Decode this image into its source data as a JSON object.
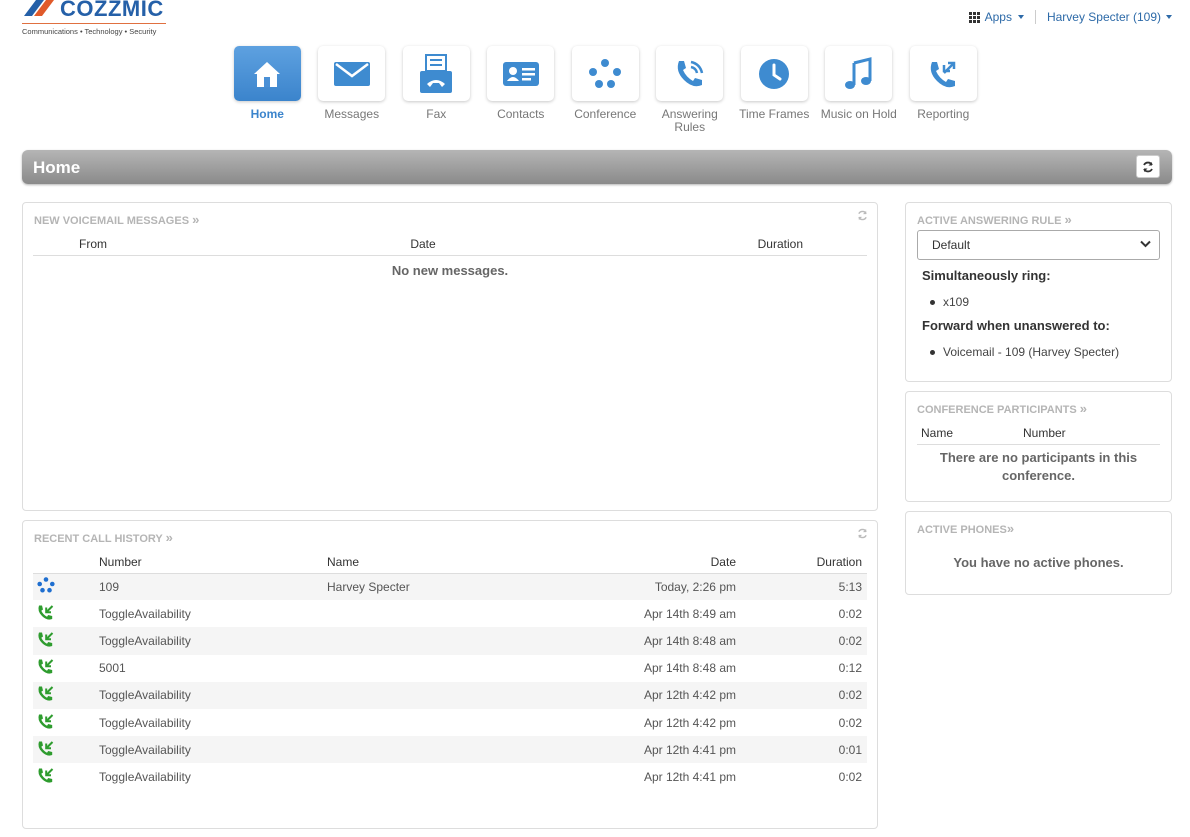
{
  "logo": {
    "brand": "COZZMIC",
    "tagline": "Communications • Technology • Security"
  },
  "topbar": {
    "apps_label": "Apps",
    "user_label": "Harvey Specter (109)"
  },
  "nav": {
    "items": [
      {
        "label": "Home",
        "icon": "home-icon",
        "active": true
      },
      {
        "label": "Messages",
        "icon": "envelope-icon",
        "active": false
      },
      {
        "label": "Fax",
        "icon": "fax-icon",
        "active": false
      },
      {
        "label": "Contacts",
        "icon": "contact-card-icon",
        "active": false
      },
      {
        "label": "Conference",
        "icon": "conference-dots-icon",
        "active": false
      },
      {
        "label": "Answering Rules",
        "icon": "phone-ringing-icon",
        "active": false
      },
      {
        "label": "Time Frames",
        "icon": "clock-icon",
        "active": false
      },
      {
        "label": "Music on Hold",
        "icon": "music-note-icon",
        "active": false
      },
      {
        "label": "Reporting",
        "icon": "phone-arrows-icon",
        "active": false
      }
    ]
  },
  "page": {
    "title": "Home"
  },
  "voicemail": {
    "title": "NEW VOICEMAIL MESSAGES",
    "columns": {
      "from": "From",
      "date": "Date",
      "duration": "Duration"
    },
    "empty": "No new messages."
  },
  "call_history": {
    "title": "RECENT CALL HISTORY",
    "columns": {
      "number": "Number",
      "name": "Name",
      "date": "Date",
      "duration": "Duration"
    },
    "rows": [
      {
        "icon": "conference-dots-icon",
        "number": "109",
        "number_is_link": true,
        "name": "Harvey Specter",
        "date": "Today, 2:26 pm",
        "duration": "5:13"
      },
      {
        "icon": "phone-incoming-icon",
        "number": "ToggleAvailability",
        "number_is_link": false,
        "name": "",
        "date": "Apr 14th 8:49 am",
        "duration": "0:02"
      },
      {
        "icon": "phone-incoming-icon",
        "number": "ToggleAvailability",
        "number_is_link": false,
        "name": "",
        "date": "Apr 14th 8:48 am",
        "duration": "0:02"
      },
      {
        "icon": "phone-incoming-icon",
        "number": "5001",
        "number_is_link": true,
        "name": "",
        "date": "Apr 14th 8:48 am",
        "duration": "0:12"
      },
      {
        "icon": "phone-incoming-icon",
        "number": "ToggleAvailability",
        "number_is_link": false,
        "name": "",
        "date": "Apr 12th 4:42 pm",
        "duration": "0:02"
      },
      {
        "icon": "phone-incoming-icon",
        "number": "ToggleAvailability",
        "number_is_link": false,
        "name": "",
        "date": "Apr 12th 4:42 pm",
        "duration": "0:02"
      },
      {
        "icon": "phone-incoming-icon",
        "number": "ToggleAvailability",
        "number_is_link": false,
        "name": "",
        "date": "Apr 12th 4:41 pm",
        "duration": "0:01"
      },
      {
        "icon": "phone-incoming-icon",
        "number": "ToggleAvailability",
        "number_is_link": false,
        "name": "",
        "date": "Apr 12th 4:41 pm",
        "duration": "0:02"
      }
    ]
  },
  "answering_rule": {
    "title": "ACTIVE ANSWERING RULE",
    "selected": "Default",
    "sim_ring_label": "Simultaneously ring:",
    "sim_ring_items": [
      "x109"
    ],
    "forward_label": "Forward when unanswered to:",
    "forward_items": [
      "Voicemail - 109 (Harvey Specter)"
    ]
  },
  "conference": {
    "title": "CONFERENCE PARTICIPANTS",
    "columns": {
      "name": "Name",
      "number": "Number"
    },
    "empty": "There are no participants in this conference."
  },
  "phones": {
    "title": "ACTIVE PHONES",
    "empty": "You have no active phones."
  },
  "colors": {
    "accent": "#3b84cc",
    "link": "#2d6aa8",
    "call_icon_green": "#2e9c2e",
    "conference_blue": "#1f6fd0"
  }
}
